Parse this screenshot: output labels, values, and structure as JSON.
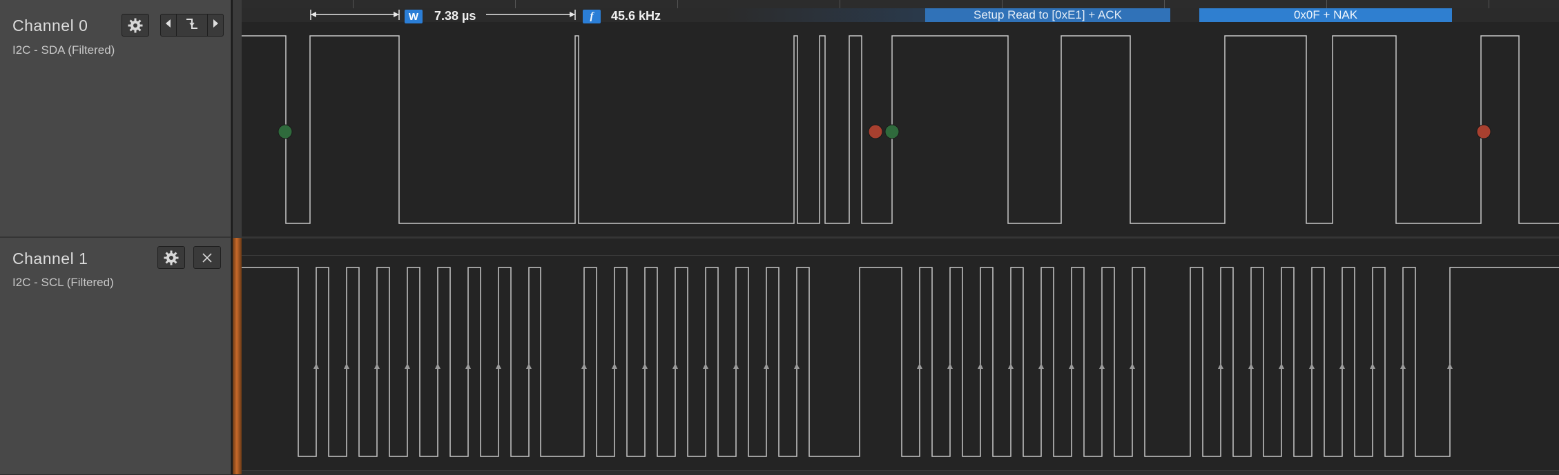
{
  "channels": [
    {
      "name": "Channel 0",
      "subtitle": "I2C - SDA (Filtered)",
      "buttons": [
        "gear-icon",
        "prev-edge-icon",
        "falling-edge-icon",
        "next-edge-icon"
      ]
    },
    {
      "name": "Channel 1",
      "subtitle": "I2C - SCL (Filtered)",
      "buttons": [
        "gear-icon",
        "close-icon"
      ]
    }
  ],
  "measurements": {
    "width_badge": "W",
    "width_value": "7.38 µs",
    "freq_badge": "f",
    "freq_value": "45.6 kHz"
  },
  "annotations": {
    "setup": "Setup Read to [0xE1] + ACK",
    "data": "0x0F + NAK"
  },
  "colors": {
    "panel_bg": "#484848",
    "wave_bg": "#242424",
    "trace": "#c8c8c8",
    "annotation_blue": "#2f7fd0",
    "start_marker": "#2f6a3c",
    "stop_marker": "#a8402f",
    "selected_channel": "#c8692a"
  }
}
